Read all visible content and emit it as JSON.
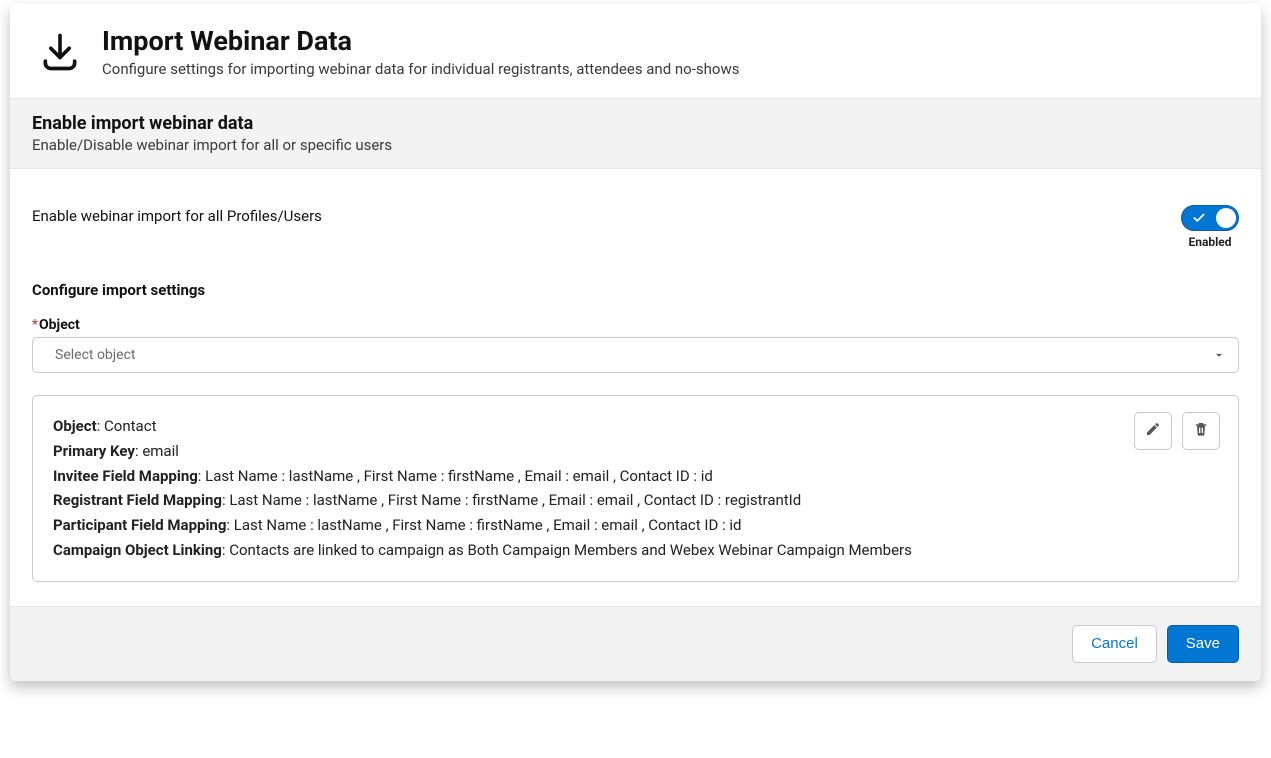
{
  "header": {
    "title": "Import Webinar Data",
    "subtitle": "Configure settings for importing webinar data for individual registrants, attendees and no-shows"
  },
  "section": {
    "title": "Enable import webinar data",
    "desc": "Enable/Disable webinar import for all or specific users"
  },
  "toggle": {
    "label": "Enable webinar import for all Profiles/Users",
    "state_label": "Enabled",
    "enabled": true
  },
  "configure": {
    "heading": "Configure import settings",
    "object_field": {
      "label": "Object",
      "required": true,
      "placeholder": "Select object"
    }
  },
  "mapping": {
    "object_label": "Object",
    "object_value": "Contact",
    "pk_label": "Primary Key",
    "pk_value": "email",
    "invitee_label": "Invitee Field Mapping",
    "invitee_value": "Last Name : lastName , First Name : firstName , Email : email , Contact ID : id",
    "registrant_label": "Registrant Field Mapping",
    "registrant_value": "Last Name : lastName , First Name : firstName , Email : email , Contact ID : registrantId",
    "participant_label": "Participant Field Mapping",
    "participant_value": "Last Name : lastName , First Name : firstName , Email : email , Contact ID : id",
    "campaign_label": "Campaign Object Linking",
    "campaign_value": "Contacts are linked to campaign as Both Campaign Members and Webex Webinar Campaign Members"
  },
  "footer": {
    "cancel": "Cancel",
    "save": "Save"
  }
}
